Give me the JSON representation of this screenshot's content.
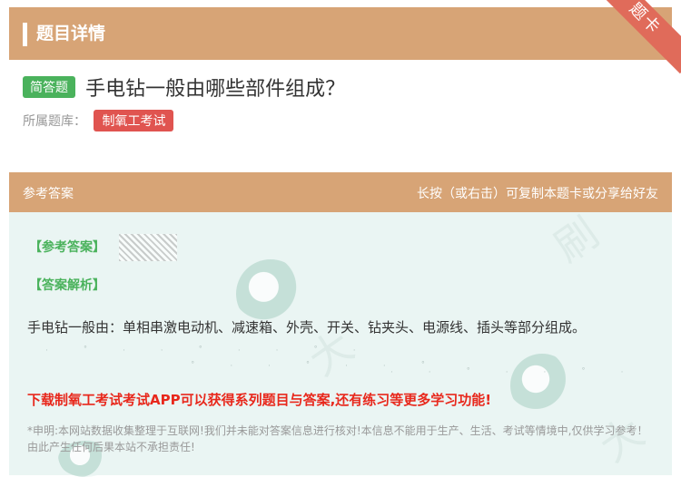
{
  "header": {
    "title": "题目详情",
    "corner_badge": "题卡"
  },
  "question": {
    "type_tag": "简答题",
    "text": "手电钻一般由哪些部件组成？",
    "bank_label": "所属题库：",
    "bank_name": "制氧工考试"
  },
  "answer_section": {
    "title": "参考答案",
    "hint": "长按（或右击）可复制本题卡或分享给好友",
    "ref_answer_label": "【参考答案】",
    "analysis_label": "【答案解析】",
    "analysis_text": "手电钻一般由：单相串激电动机、减速箱、外壳、开关、钻夹头、电源线、插头等部分组成。",
    "promo_text": "下载制氧工考试考试APP可以获得系列题目与答案,还有练习等更多学习功能!",
    "disclaimer": "*申明:本网站数据收集整理于互联网!我们并未能对答案信息进行核对!本信息不能用于生产、生活、考试等情境中,仅供学习参考！由此产生任何后果本站不承担责任!"
  },
  "colors": {
    "accent": "#d7a476",
    "green": "#4ab25c",
    "red": "#e05450",
    "promo_red": "#e8281c",
    "body_bg": "#eaf5f3"
  }
}
